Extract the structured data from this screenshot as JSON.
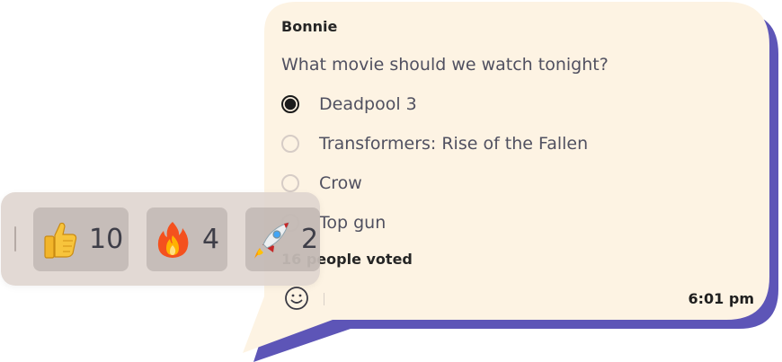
{
  "message": {
    "sender": "Bonnie",
    "question": "What movie should we watch tonight?",
    "options": [
      {
        "label": "Deadpool 3",
        "selected": true
      },
      {
        "label": "Transformers: Rise of the Fallen",
        "selected": false
      },
      {
        "label": "Crow",
        "selected": false
      },
      {
        "label": "Top gun",
        "selected": false
      }
    ],
    "votes_text": "16 people voted",
    "time": "6:01 pm"
  },
  "reactions": [
    {
      "icon": "thumbs-up-icon",
      "count": "10"
    },
    {
      "icon": "fire-icon",
      "count": "4"
    },
    {
      "icon": "rocket-icon",
      "count": "2"
    }
  ],
  "colors": {
    "bubble": "#fdf3e3",
    "bubble_shadow": "#5d55b7",
    "reaction_bar": "#ded4ce"
  }
}
